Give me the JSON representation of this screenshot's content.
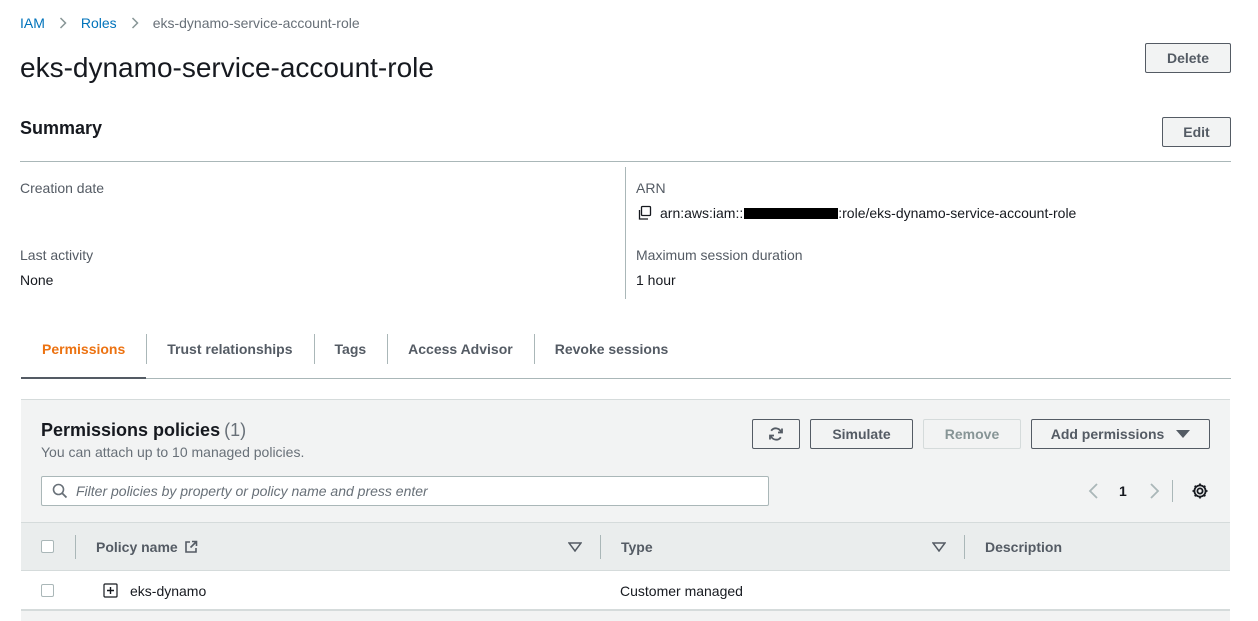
{
  "breadcrumb": {
    "items": [
      "IAM",
      "Roles"
    ],
    "current": "eks-dynamo-service-account-role"
  },
  "page": {
    "title": "eks-dynamo-service-account-role",
    "delete_label": "Delete"
  },
  "summary": {
    "title": "Summary",
    "edit_label": "Edit",
    "creation_date_label": "Creation date",
    "creation_date_value": "",
    "last_activity_label": "Last activity",
    "last_activity_value": "None",
    "arn_label": "ARN",
    "arn_prefix": "arn:aws:iam::",
    "arn_suffix": ":role/eks-dynamo-service-account-role",
    "max_session_label": "Maximum session duration",
    "max_session_value": "1 hour"
  },
  "tabs": [
    {
      "label": "Permissions",
      "active": true
    },
    {
      "label": "Trust relationships",
      "active": false
    },
    {
      "label": "Tags",
      "active": false
    },
    {
      "label": "Access Advisor",
      "active": false
    },
    {
      "label": "Revoke sessions",
      "active": false
    }
  ],
  "policies": {
    "title": "Permissions policies",
    "count": "(1)",
    "description": "You can attach up to 10 managed policies.",
    "simulate_label": "Simulate",
    "remove_label": "Remove",
    "add_permissions_label": "Add permissions",
    "filter_placeholder": "Filter policies by property or policy name and press enter",
    "page_number": "1",
    "columns": {
      "policy_name": "Policy name",
      "type": "Type",
      "description": "Description"
    },
    "rows": [
      {
        "policy_name": "eks-dynamo",
        "type": "Customer managed",
        "description": ""
      }
    ]
  },
  "colors": {
    "link": "#0073bb",
    "active_tab": "#ec7211",
    "panel_bg": "#f2f3f3"
  }
}
